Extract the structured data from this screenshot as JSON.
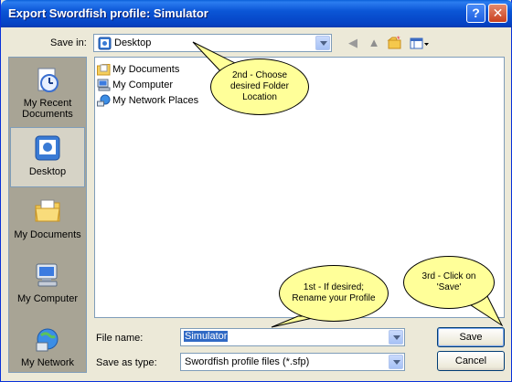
{
  "window": {
    "title": "Export Swordfish profile: Simulator"
  },
  "titlebar_buttons": {
    "help": "?",
    "close": "✕"
  },
  "save_in": {
    "label": "Save in:",
    "value": "Desktop"
  },
  "places": [
    {
      "label": "My Recent Documents",
      "icon": "recent-documents-icon"
    },
    {
      "label": "Desktop",
      "icon": "desktop-icon"
    },
    {
      "label": "My Documents",
      "icon": "my-documents-icon"
    },
    {
      "label": "My Computer",
      "icon": "my-computer-icon"
    },
    {
      "label": "My Network",
      "icon": "my-network-icon"
    }
  ],
  "files": [
    {
      "name": "My Documents",
      "icon": "folder-icon"
    },
    {
      "name": "My Computer",
      "icon": "computer-icon"
    },
    {
      "name": "My Network Places",
      "icon": "network-icon"
    }
  ],
  "file_name": {
    "label": "File name:",
    "value": "Simulator"
  },
  "save_as_type": {
    "label": "Save as type:",
    "value": "Swordfish profile files (*.sfp)"
  },
  "buttons": {
    "save": "Save",
    "cancel": "Cancel"
  },
  "callouts": {
    "folder": "2nd - Choose desired Folder Location",
    "rename": "1st - If desired; Rename your Profile",
    "save": "3rd - Click on 'Save'"
  },
  "colors": {
    "title_bar": "#0b56d6",
    "callout_fill": "#ffff99",
    "dialog_bg": "#ece9d8"
  }
}
